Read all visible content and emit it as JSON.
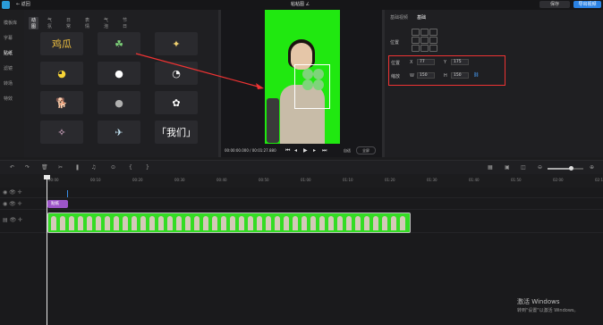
{
  "app": {
    "back_label": "← 返回",
    "project_name": "粘粘图 ∠"
  },
  "top_buttons": {
    "save": "保存",
    "export": "导出视频"
  },
  "left_nav": [
    {
      "label": "模板库"
    },
    {
      "label": "字幕"
    },
    {
      "label": "贴纸",
      "active": true
    },
    {
      "label": "滤镜"
    },
    {
      "label": "转场"
    },
    {
      "label": "特效"
    }
  ],
  "asset_tabs": [
    {
      "label": "动图",
      "active": true
    },
    {
      "label": "气氛"
    },
    {
      "label": "日常"
    },
    {
      "label": "表情"
    },
    {
      "label": "气泡"
    },
    {
      "label": "节日"
    }
  ],
  "stickers": [
    {
      "icon": "ji-gua-text-sticker",
      "glyph": "鸡瓜",
      "color": "#f0c040"
    },
    {
      "icon": "clover-sticker",
      "glyph": "☘",
      "color": "#7ed47a"
    },
    {
      "icon": "wheat-sticker",
      "glyph": "✦",
      "color": "#f0d070"
    },
    {
      "icon": "yellow-face-sticker",
      "glyph": "◕",
      "color": "#f7d437"
    },
    {
      "icon": "round-face-sticker",
      "glyph": "●",
      "color": "#ffffff"
    },
    {
      "icon": "blob-face-sticker",
      "glyph": "◔",
      "color": "#f2f2f2"
    },
    {
      "icon": "dog-text-sticker",
      "glyph": "🐕",
      "color": "#ffffff"
    },
    {
      "icon": "cat-ball-sticker",
      "glyph": "●",
      "color": "#b0b0b0"
    },
    {
      "icon": "white-flower-sticker",
      "glyph": "✿",
      "color": "#ffffff"
    },
    {
      "icon": "kids-text-sticker",
      "glyph": "✧",
      "color": "#f5c0e0"
    },
    {
      "icon": "bird-sticker",
      "glyph": "✈",
      "color": "#c0e0f0"
    },
    {
      "icon": "heart-text-sticker",
      "glyph": "「我们」",
      "color": "#ffffff"
    }
  ],
  "player": {
    "timecode": "00:00:00.000 / 00:01:27.880",
    "fit_label": "自适",
    "fullscreen_label": "全屏"
  },
  "right_panel": {
    "tabs": [
      {
        "label": "基础视频"
      },
      {
        "label": "基础",
        "active": true
      }
    ],
    "position_label": "位置",
    "position_row_label": "位置",
    "size_row_label": "缩放",
    "x_label": "X",
    "x_value": "77",
    "y_label": "Y",
    "y_value": "175",
    "w_label": "W",
    "w_value": "150",
    "h_label": "H",
    "h_value": "150"
  },
  "timeline": {
    "ruler_labels": [
      "00:00",
      "00:10",
      "00:20",
      "00:30",
      "00:40",
      "00:50",
      "01:00",
      "01:10",
      "01:20",
      "01:30",
      "01:40",
      "01:50",
      "02:00",
      "02:10"
    ],
    "sticker_clip_label": "贴纸",
    "zoom_level": 0.65
  },
  "watermark": {
    "line1": "激活 Windows",
    "line2": "转到\"设置\"以激活 Windows。"
  }
}
